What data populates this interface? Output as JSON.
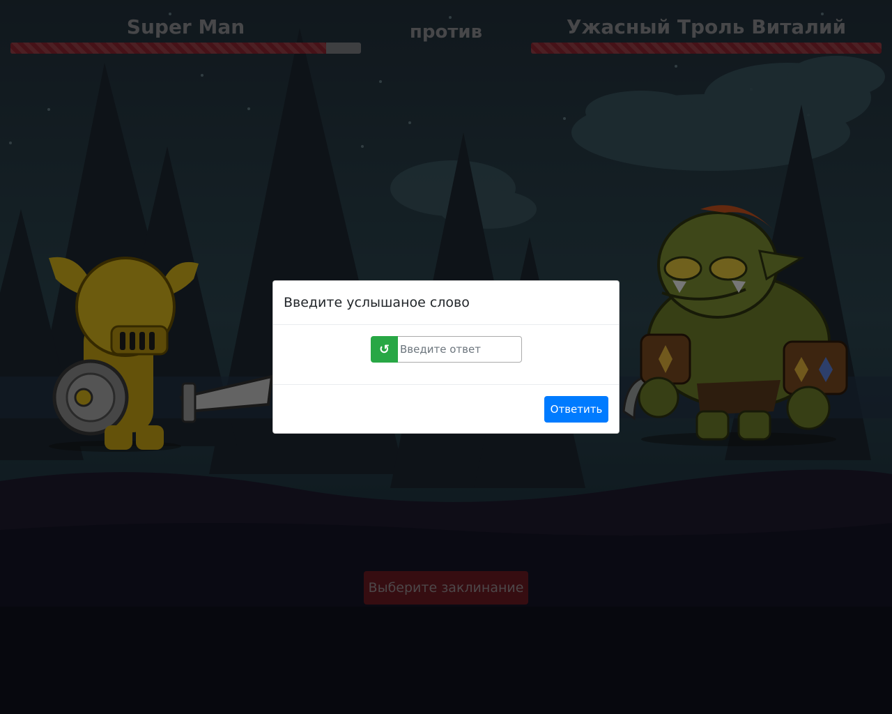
{
  "hud": {
    "player_name": "Super Man",
    "versus": "против",
    "enemy_name": "Ужасный Троль Виталий",
    "player_hp_fraction": 0.9,
    "enemy_hp_fraction": 1.0
  },
  "modal": {
    "title": "Введите услышаное слово",
    "replay_icon": "↺",
    "answer_placeholder": "Введите ответ",
    "submit_label": "Ответить"
  },
  "spell_button_label": "Выберите заклинание",
  "icons": {
    "replay": "replay-icon"
  },
  "colors": {
    "hp_fill": "#8d2530",
    "hp_empty": "#7c7e82",
    "submit": "#007bff",
    "replay": "#28a745",
    "spell": "#6c1a23"
  }
}
